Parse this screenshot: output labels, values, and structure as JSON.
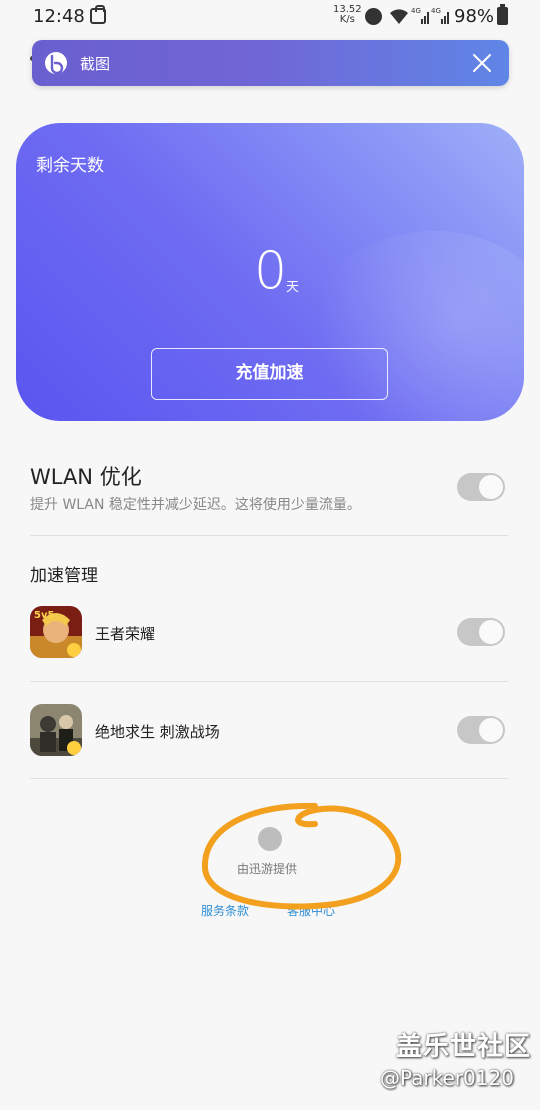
{
  "status_bar": {
    "time": "12:48",
    "net_speed_value": "13.52",
    "net_speed_unit": "K/s",
    "sig1_label": "4G",
    "sig2_label": "4G",
    "battery": "98%"
  },
  "banner": {
    "title": "截图",
    "icon": "bixby-b-icon",
    "close_icon": "close-icon"
  },
  "card": {
    "label": "剩余天数",
    "value": "0",
    "unit": "天",
    "button_label": "充值加速",
    "gradient_start": "#5a55f0",
    "gradient_end": "#9fb0f8"
  },
  "wlan": {
    "title": "WLAN 优化",
    "description": "提升 WLAN 稳定性并减少延迟。这将使用少量流量。",
    "enabled": false
  },
  "accel": {
    "title": "加速管理",
    "games": [
      {
        "name": "王者荣耀",
        "icon": "honor-of-kings-icon",
        "enabled": false
      },
      {
        "name": "绝地求生 刺激战场",
        "icon": "pubg-icon",
        "enabled": false
      }
    ]
  },
  "footer": {
    "provider": "由迅游提供",
    "terms": "服务条款",
    "support": "客服中心",
    "link_color": "#2f8fd6"
  },
  "watermark": {
    "brand": "盖乐世社区",
    "user": "@Parker0120"
  }
}
